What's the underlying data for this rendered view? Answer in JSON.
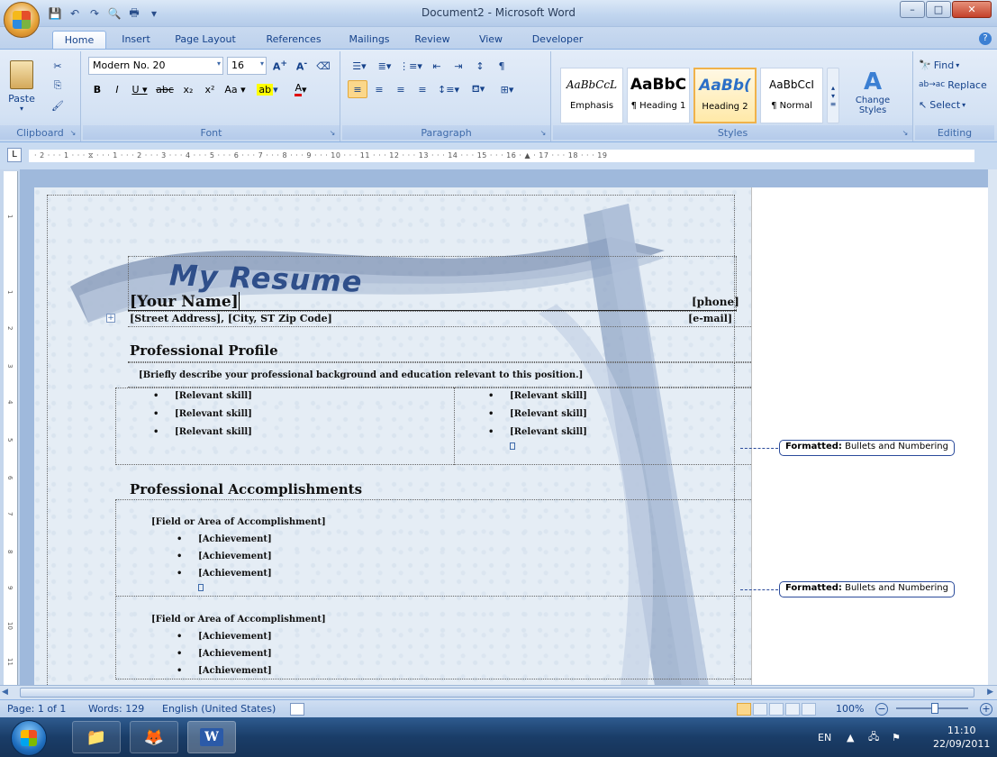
{
  "window": {
    "title": "Document2 - Microsoft Word",
    "minimize": "–",
    "maximize": "□",
    "close": "✕"
  },
  "tabs": [
    "Home",
    "Insert",
    "Page Layout",
    "References",
    "Mailings",
    "Review",
    "View",
    "Developer"
  ],
  "ribbon": {
    "clipboard": {
      "paste_label": "Paste",
      "group_label": "Clipboard"
    },
    "font": {
      "font_name": "Modern No. 20",
      "font_size": "16",
      "group_label": "Font"
    },
    "paragraph": {
      "group_label": "Paragraph"
    },
    "styles": {
      "group_label": "Styles",
      "items": [
        {
          "preview": "AaBbCcL",
          "name": "Emphasis"
        },
        {
          "preview": "AaBbC",
          "name": "¶ Heading 1"
        },
        {
          "preview": "AaBb(",
          "name": "Heading 2"
        },
        {
          "preview": "AaBbCcI",
          "name": "¶ Normal"
        }
      ],
      "change_styles": "Change Styles"
    },
    "editing": {
      "group_label": "Editing",
      "find": "Find",
      "replace": "Replace",
      "select": "Select"
    }
  },
  "ruler": {
    "corner": "L",
    "labels": "· 2 · · · 1 · · · ⧖ · · · 1 · · · 2 · · · 3 · · · 4 · · · 5 · · · 6 · · · 7 · · · 8 · · · 9 · · · 10 · · · 11 · · · 12 · · · 13 · · · 14 · · · 15 · · · 16 · ▲ · 17 · · · 18 · · · 19",
    "vertical": [
      "1",
      "1",
      "2",
      "3",
      "4",
      "5",
      "6",
      "7",
      "8",
      "9",
      "10",
      "11"
    ]
  },
  "document": {
    "banner_title": "My Resume",
    "name": "[Your Name]",
    "phone": "[phone]",
    "address": "[Street Address], [City, ST  Zip Code]",
    "email": "[e-mail]",
    "profile_heading": "Professional Profile",
    "profile_text": "[Briefly describe your professional background and education relevant to this position.]",
    "skills_left": [
      "[Relevant skill]",
      "[Relevant skill]",
      "[Relevant skill]"
    ],
    "skills_right": [
      "[Relevant skill]",
      "[Relevant skill]",
      "[Relevant skill]"
    ],
    "accomplishments_heading": "Professional Accomplishments",
    "field1": "[Field or Area of Accomplishment]",
    "achievements1": [
      "[Achievement]",
      "[Achievement]",
      "[Achievement]"
    ],
    "field2": "[Field or Area of Accomplishment]",
    "achievements2": [
      "[Achievement]",
      "[Achievement]",
      "[Achievement]"
    ]
  },
  "balloons": [
    {
      "label": "Formatted:",
      "text": "Bullets and Numbering"
    },
    {
      "label": "Formatted:",
      "text": "Bullets and Numbering"
    }
  ],
  "statusbar": {
    "page": "Page: 1 of 1",
    "words": "Words: 129",
    "language": "English (United States)",
    "zoom": "100%"
  },
  "taskbar": {
    "language": "EN",
    "time": "11:10",
    "date": "22/09/2011"
  }
}
